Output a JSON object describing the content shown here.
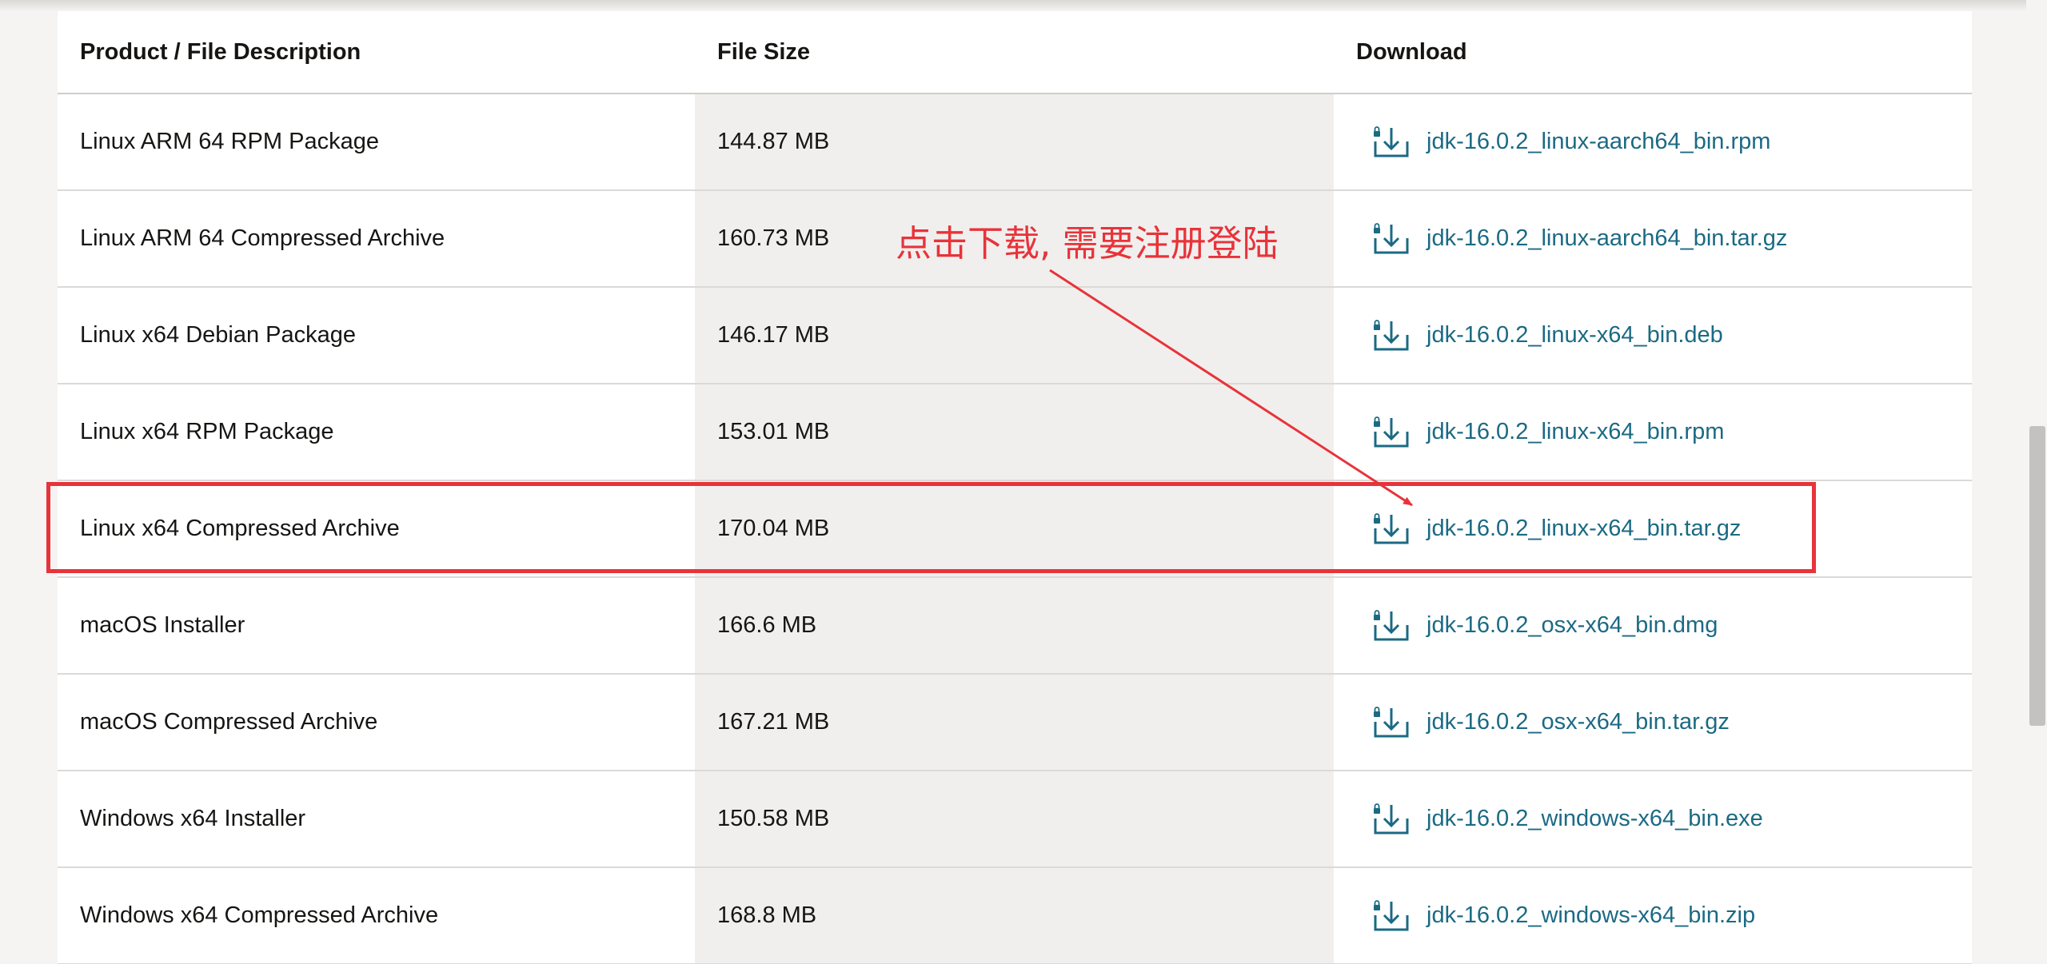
{
  "table": {
    "headers": {
      "description": "Product / File Description",
      "size": "File Size",
      "download": "Download"
    },
    "rows": [
      {
        "description": "Linux ARM 64 RPM Package",
        "size": "144.87 MB",
        "file": "jdk-16.0.2_linux-aarch64_bin.rpm"
      },
      {
        "description": "Linux ARM 64 Compressed Archive",
        "size": "160.73 MB",
        "file": "jdk-16.0.2_linux-aarch64_bin.tar.gz"
      },
      {
        "description": "Linux x64 Debian Package",
        "size": "146.17 MB",
        "file": "jdk-16.0.2_linux-x64_bin.deb"
      },
      {
        "description": "Linux x64 RPM Package",
        "size": "153.01 MB",
        "file": "jdk-16.0.2_linux-x64_bin.rpm"
      },
      {
        "description": "Linux x64 Compressed Archive",
        "size": "170.04 MB",
        "file": "jdk-16.0.2_linux-x64_bin.tar.gz"
      },
      {
        "description": "macOS Installer",
        "size": "166.6 MB",
        "file": "jdk-16.0.2_osx-x64_bin.dmg"
      },
      {
        "description": "macOS Compressed Archive",
        "size": "167.21 MB",
        "file": "jdk-16.0.2_osx-x64_bin.tar.gz"
      },
      {
        "description": "Windows x64 Installer",
        "size": "150.58 MB",
        "file": "jdk-16.0.2_windows-x64_bin.exe"
      },
      {
        "description": "Windows x64 Compressed Archive",
        "size": "168.8 MB",
        "file": "jdk-16.0.2_windows-x64_bin.zip"
      }
    ]
  },
  "annotation": {
    "text": "点击下载, 需要注册登陆"
  },
  "icons": {
    "download": "lock-download-icon"
  },
  "colors": {
    "link": "#1b6a83",
    "annotation": "#e8333a",
    "size_column_bg": "#f1efed"
  }
}
